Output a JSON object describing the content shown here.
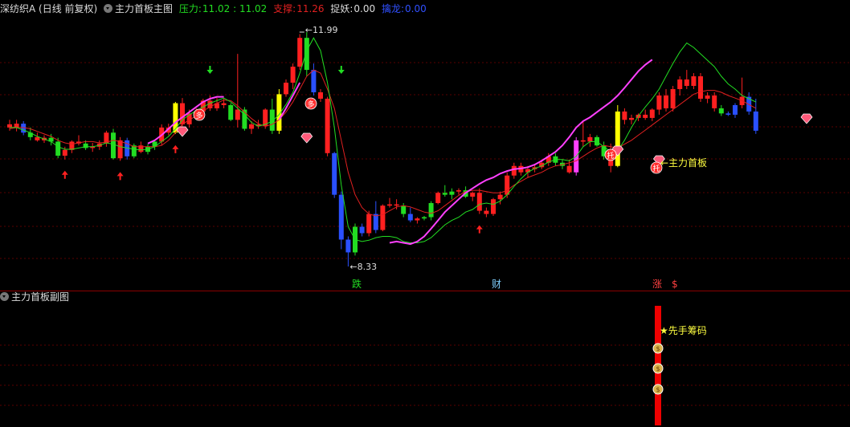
{
  "main_header": {
    "security": "深纺织A (日线 前复权)",
    "indicator": "主力首板主图",
    "pressure_label": "压力:",
    "pressure_value": "11.02 : 11.02",
    "support_label": "支撑:",
    "support_value": "11.26",
    "catch_label": "捉妖:",
    "catch_value": "0.00",
    "capture_label": "擒龙:",
    "capture_value": "0.00"
  },
  "sub_header": {
    "indicator": "主力首板副图"
  },
  "annotations": {
    "high_price": "11.99",
    "low_price": "8.33",
    "first_board": "主力首板",
    "first_chips": "★先手筹码",
    "markers": [
      "跌",
      "财",
      "涨",
      "$"
    ],
    "badge_multi": "多",
    "badge_tuo": "托"
  },
  "colors": {
    "background": "#000000",
    "up": "#ff2020",
    "down": "#2a50ff",
    "green_candle": "#22dd22",
    "ma_red": "#e02020",
    "ma_green": "#22dd22",
    "ma_magenta": "#ff40ff",
    "highlight_yellow": "#ffff00",
    "grid": "#5a0000"
  },
  "chart_data": {
    "type": "candlestick",
    "price_range": [
      8.33,
      11.99
    ],
    "candles": [
      {
        "o": 10.55,
        "h": 10.62,
        "l": 10.45,
        "c": 10.5,
        "k": "u"
      },
      {
        "o": 10.5,
        "h": 10.62,
        "l": 10.44,
        "c": 10.56,
        "k": "u"
      },
      {
        "o": 10.56,
        "h": 10.6,
        "l": 10.38,
        "c": 10.42,
        "k": "d"
      },
      {
        "o": 10.42,
        "h": 10.5,
        "l": 10.3,
        "c": 10.35,
        "k": "g"
      },
      {
        "o": 10.35,
        "h": 10.42,
        "l": 10.28,
        "c": 10.3,
        "k": "u"
      },
      {
        "o": 10.3,
        "h": 10.38,
        "l": 10.26,
        "c": 10.34,
        "k": "u"
      },
      {
        "o": 10.34,
        "h": 10.4,
        "l": 10.22,
        "c": 10.28,
        "k": "g"
      },
      {
        "o": 10.28,
        "h": 10.34,
        "l": 10.02,
        "c": 10.06,
        "k": "g"
      },
      {
        "o": 10.06,
        "h": 10.2,
        "l": 10.0,
        "c": 10.15,
        "k": "u"
      },
      {
        "o": 10.15,
        "h": 10.3,
        "l": 10.1,
        "c": 10.28,
        "k": "u"
      },
      {
        "o": 10.28,
        "h": 10.38,
        "l": 10.22,
        "c": 10.25,
        "k": "u"
      },
      {
        "o": 10.25,
        "h": 10.3,
        "l": 10.15,
        "c": 10.18,
        "k": "g"
      },
      {
        "o": 10.18,
        "h": 10.26,
        "l": 10.12,
        "c": 10.2,
        "k": "u"
      },
      {
        "o": 10.2,
        "h": 10.3,
        "l": 10.15,
        "c": 10.25,
        "k": "u"
      },
      {
        "o": 10.25,
        "h": 10.45,
        "l": 10.2,
        "c": 10.42,
        "k": "u"
      },
      {
        "o": 10.42,
        "h": 10.48,
        "l": 10.0,
        "c": 10.02,
        "k": "g"
      },
      {
        "o": 10.02,
        "h": 10.35,
        "l": 9.98,
        "c": 10.3,
        "k": "u"
      },
      {
        "o": 10.3,
        "h": 10.34,
        "l": 10.0,
        "c": 10.05,
        "k": "d"
      },
      {
        "o": 10.05,
        "h": 10.25,
        "l": 10.02,
        "c": 10.22,
        "k": "g"
      },
      {
        "o": 10.22,
        "h": 10.28,
        "l": 10.1,
        "c": 10.12,
        "k": "u"
      },
      {
        "o": 10.12,
        "h": 10.24,
        "l": 10.08,
        "c": 10.2,
        "k": "g"
      },
      {
        "o": 10.2,
        "h": 10.3,
        "l": 10.15,
        "c": 10.28,
        "k": "g"
      },
      {
        "o": 10.28,
        "h": 10.55,
        "l": 10.22,
        "c": 10.5,
        "k": "u"
      },
      {
        "o": 10.5,
        "h": 10.56,
        "l": 10.38,
        "c": 10.42,
        "k": "u"
      },
      {
        "o": 10.42,
        "h": 10.9,
        "l": 10.4,
        "c": 10.88,
        "k": "y"
      },
      {
        "o": 10.88,
        "h": 10.96,
        "l": 10.5,
        "c": 10.55,
        "k": "u"
      },
      {
        "o": 10.55,
        "h": 10.78,
        "l": 10.5,
        "c": 10.72,
        "k": "u"
      },
      {
        "o": 10.72,
        "h": 10.8,
        "l": 10.66,
        "c": 10.75,
        "k": "u"
      },
      {
        "o": 10.75,
        "h": 10.95,
        "l": 10.7,
        "c": 10.92,
        "k": "u"
      },
      {
        "o": 10.92,
        "h": 11.0,
        "l": 10.76,
        "c": 10.8,
        "k": "u"
      },
      {
        "o": 10.8,
        "h": 10.96,
        "l": 10.76,
        "c": 10.88,
        "k": "u"
      },
      {
        "o": 10.88,
        "h": 10.95,
        "l": 10.8,
        "c": 10.85,
        "k": "u"
      },
      {
        "o": 10.85,
        "h": 10.88,
        "l": 10.6,
        "c": 10.62,
        "k": "g"
      },
      {
        "o": 10.62,
        "h": 11.65,
        "l": 10.5,
        "c": 10.78,
        "k": "u"
      },
      {
        "o": 10.78,
        "h": 10.82,
        "l": 10.45,
        "c": 10.48,
        "k": "g"
      },
      {
        "o": 10.48,
        "h": 10.6,
        "l": 10.4,
        "c": 10.55,
        "k": "u"
      },
      {
        "o": 10.55,
        "h": 10.62,
        "l": 10.48,
        "c": 10.52,
        "k": "u"
      },
      {
        "o": 10.52,
        "h": 10.8,
        "l": 10.48,
        "c": 10.78,
        "k": "u"
      },
      {
        "o": 10.78,
        "h": 10.95,
        "l": 10.4,
        "c": 10.45,
        "k": "g"
      },
      {
        "o": 10.45,
        "h": 11.1,
        "l": 10.4,
        "c": 11.02,
        "k": "y"
      },
      {
        "o": 11.02,
        "h": 11.25,
        "l": 10.98,
        "c": 11.2,
        "k": "u"
      },
      {
        "o": 11.2,
        "h": 11.5,
        "l": 11.1,
        "c": 11.45,
        "k": "u"
      },
      {
        "o": 11.45,
        "h": 11.96,
        "l": 11.4,
        "c": 11.9,
        "k": "u"
      },
      {
        "o": 11.9,
        "h": 11.99,
        "l": 11.3,
        "c": 11.4,
        "k": "g"
      },
      {
        "o": 11.4,
        "h": 11.5,
        "l": 11.0,
        "c": 11.05,
        "k": "d"
      },
      {
        "o": 11.05,
        "h": 11.1,
        "l": 10.9,
        "c": 10.95,
        "k": "u"
      },
      {
        "o": 10.95,
        "h": 10.98,
        "l": 10.05,
        "c": 10.1,
        "k": "u"
      },
      {
        "o": 10.1,
        "h": 10.12,
        "l": 9.4,
        "c": 9.45,
        "k": "d"
      },
      {
        "o": 9.45,
        "h": 9.5,
        "l": 8.6,
        "c": 8.75,
        "k": "d"
      },
      {
        "o": 8.75,
        "h": 8.8,
        "l": 8.33,
        "c": 8.55,
        "k": "d"
      },
      {
        "o": 8.55,
        "h": 9.0,
        "l": 8.5,
        "c": 8.95,
        "k": "g"
      },
      {
        "o": 8.95,
        "h": 9.0,
        "l": 8.8,
        "c": 8.85,
        "k": "d"
      },
      {
        "o": 8.85,
        "h": 9.2,
        "l": 8.8,
        "c": 9.15,
        "k": "u"
      },
      {
        "o": 9.15,
        "h": 9.35,
        "l": 8.85,
        "c": 8.9,
        "k": "d"
      },
      {
        "o": 8.9,
        "h": 9.3,
        "l": 8.88,
        "c": 9.28,
        "k": "u"
      },
      {
        "o": 9.28,
        "h": 9.4,
        "l": 9.25,
        "c": 9.3,
        "k": "u"
      },
      {
        "o": 9.3,
        "h": 9.38,
        "l": 9.22,
        "c": 9.28,
        "k": "u"
      },
      {
        "o": 9.28,
        "h": 9.32,
        "l": 9.1,
        "c": 9.15,
        "k": "g"
      },
      {
        "o": 9.15,
        "h": 9.25,
        "l": 9.02,
        "c": 9.05,
        "k": "d"
      },
      {
        "o": 9.05,
        "h": 9.1,
        "l": 9.0,
        "c": 9.08,
        "k": "u"
      },
      {
        "o": 9.08,
        "h": 9.12,
        "l": 9.05,
        "c": 9.1,
        "k": "g"
      },
      {
        "o": 9.1,
        "h": 9.35,
        "l": 9.05,
        "c": 9.32,
        "k": "g"
      },
      {
        "o": 9.32,
        "h": 9.5,
        "l": 9.3,
        "c": 9.48,
        "k": "u"
      },
      {
        "o": 9.48,
        "h": 9.6,
        "l": 9.42,
        "c": 9.45,
        "k": "g"
      },
      {
        "o": 9.45,
        "h": 9.55,
        "l": 9.38,
        "c": 9.5,
        "k": "g"
      },
      {
        "o": 9.5,
        "h": 9.55,
        "l": 9.45,
        "c": 9.52,
        "k": "u"
      },
      {
        "o": 9.52,
        "h": 9.58,
        "l": 9.4,
        "c": 9.42,
        "k": "g"
      },
      {
        "o": 9.42,
        "h": 9.5,
        "l": 9.35,
        "c": 9.48,
        "k": "u"
      },
      {
        "o": 9.48,
        "h": 9.55,
        "l": 9.15,
        "c": 9.2,
        "k": "u"
      },
      {
        "o": 9.2,
        "h": 9.25,
        "l": 9.1,
        "c": 9.15,
        "k": "u"
      },
      {
        "o": 9.15,
        "h": 9.4,
        "l": 9.12,
        "c": 9.38,
        "k": "u"
      },
      {
        "o": 9.38,
        "h": 9.5,
        "l": 9.3,
        "c": 9.45,
        "k": "u"
      },
      {
        "o": 9.45,
        "h": 9.8,
        "l": 9.4,
        "c": 9.75,
        "k": "u"
      },
      {
        "o": 9.75,
        "h": 9.95,
        "l": 9.7,
        "c": 9.9,
        "k": "u"
      },
      {
        "o": 9.9,
        "h": 9.95,
        "l": 9.75,
        "c": 9.8,
        "k": "u"
      },
      {
        "o": 9.8,
        "h": 9.9,
        "l": 9.72,
        "c": 9.85,
        "k": "u"
      },
      {
        "o": 9.85,
        "h": 9.92,
        "l": 9.8,
        "c": 9.88,
        "k": "u"
      },
      {
        "o": 9.88,
        "h": 10.0,
        "l": 9.85,
        "c": 9.95,
        "k": "u"
      },
      {
        "o": 9.95,
        "h": 10.1,
        "l": 9.9,
        "c": 10.05,
        "k": "u"
      },
      {
        "o": 10.05,
        "h": 10.1,
        "l": 9.9,
        "c": 9.95,
        "k": "g"
      },
      {
        "o": 9.95,
        "h": 10.0,
        "l": 9.85,
        "c": 9.9,
        "k": "g"
      },
      {
        "o": 9.9,
        "h": 10.0,
        "l": 9.78,
        "c": 9.8,
        "k": "u"
      },
      {
        "o": 9.8,
        "h": 10.35,
        "l": 9.75,
        "c": 10.3,
        "k": "p"
      },
      {
        "o": 10.3,
        "h": 10.6,
        "l": 10.2,
        "c": 10.28,
        "k": "u"
      },
      {
        "o": 10.28,
        "h": 10.4,
        "l": 10.2,
        "c": 10.35,
        "k": "u"
      },
      {
        "o": 10.35,
        "h": 10.38,
        "l": 10.2,
        "c": 10.22,
        "k": "g"
      },
      {
        "o": 10.22,
        "h": 10.28,
        "l": 10.0,
        "c": 10.05,
        "k": "g"
      },
      {
        "o": 10.05,
        "h": 10.25,
        "l": 9.8,
        "c": 9.9,
        "k": "u"
      },
      {
        "o": 9.9,
        "h": 10.85,
        "l": 9.88,
        "c": 10.75,
        "k": "y"
      },
      {
        "o": 10.75,
        "h": 10.8,
        "l": 10.55,
        "c": 10.62,
        "k": "u"
      },
      {
        "o": 10.62,
        "h": 10.7,
        "l": 10.55,
        "c": 10.65,
        "k": "u"
      },
      {
        "o": 10.65,
        "h": 10.72,
        "l": 10.6,
        "c": 10.7,
        "k": "u"
      },
      {
        "o": 10.7,
        "h": 10.78,
        "l": 10.62,
        "c": 10.65,
        "k": "u"
      },
      {
        "o": 10.65,
        "h": 10.8,
        "l": 10.6,
        "c": 10.78,
        "k": "u"
      },
      {
        "o": 10.78,
        "h": 11.05,
        "l": 10.7,
        "c": 11.0,
        "k": "u"
      },
      {
        "o": 11.0,
        "h": 11.1,
        "l": 10.75,
        "c": 10.8,
        "k": "u"
      },
      {
        "o": 10.8,
        "h": 11.15,
        "l": 10.75,
        "c": 11.1,
        "k": "u"
      },
      {
        "o": 11.1,
        "h": 11.3,
        "l": 11.0,
        "c": 11.25,
        "k": "u"
      },
      {
        "o": 11.25,
        "h": 11.4,
        "l": 11.1,
        "c": 11.15,
        "k": "u"
      },
      {
        "o": 11.15,
        "h": 11.35,
        "l": 11.1,
        "c": 11.3,
        "k": "u"
      },
      {
        "o": 11.3,
        "h": 11.35,
        "l": 10.9,
        "c": 10.95,
        "k": "u"
      },
      {
        "o": 10.95,
        "h": 11.05,
        "l": 10.88,
        "c": 11.0,
        "k": "u"
      },
      {
        "o": 11.0,
        "h": 11.05,
        "l": 10.75,
        "c": 10.8,
        "k": "u"
      },
      {
        "o": 10.8,
        "h": 10.85,
        "l": 10.68,
        "c": 10.72,
        "k": "g"
      },
      {
        "o": 10.72,
        "h": 10.75,
        "l": 10.68,
        "c": 10.7,
        "k": "d"
      },
      {
        "o": 10.7,
        "h": 10.88,
        "l": 10.65,
        "c": 10.85,
        "k": "d"
      },
      {
        "o": 10.85,
        "h": 11.28,
        "l": 10.8,
        "c": 10.98,
        "k": "u"
      },
      {
        "o": 10.98,
        "h": 11.05,
        "l": 10.7,
        "c": 10.75,
        "k": "d"
      },
      {
        "o": 10.75,
        "h": 10.95,
        "l": 10.4,
        "c": 10.45,
        "k": "d"
      }
    ],
    "ma_red": [
      10.48,
      10.5,
      10.5,
      10.48,
      10.44,
      10.4,
      10.36,
      10.3,
      10.26,
      10.24,
      10.26,
      10.28,
      10.28,
      10.26,
      10.27,
      10.3,
      10.28,
      10.25,
      10.2,
      10.2,
      10.2,
      10.2,
      10.22,
      10.3,
      10.42,
      10.55,
      10.62,
      10.68,
      10.76,
      10.82,
      10.88,
      10.93,
      10.92,
      10.84,
      10.74,
      10.64,
      10.56,
      10.52,
      10.55,
      10.62,
      10.74,
      10.9,
      11.1,
      11.3,
      11.4,
      11.35,
      11.1,
      10.8,
      10.3,
      9.8,
      9.45,
      9.25,
      9.15,
      9.12,
      9.14,
      9.2,
      9.26,
      9.28,
      9.26,
      9.22,
      9.18,
      9.16,
      9.2,
      9.28,
      9.36,
      9.44,
      9.5,
      9.52,
      9.52,
      9.5,
      9.48,
      9.48,
      9.52,
      9.6,
      9.66,
      9.72,
      9.76,
      9.8,
      9.86,
      9.9,
      9.92,
      9.95,
      9.98,
      10.05,
      10.12,
      10.18,
      10.22,
      10.2,
      10.18,
      10.24,
      10.3,
      10.38,
      10.46,
      10.54,
      10.62,
      10.7,
      10.78,
      10.86,
      10.94,
      11.02,
      11.06,
      11.08,
      11.08,
      11.05,
      11.0,
      10.96,
      10.92,
      10.86,
      10.8
    ],
    "ma_green": [
      10.5,
      10.5,
      10.46,
      10.42,
      10.36,
      10.32,
      10.28,
      10.2,
      10.16,
      10.16,
      10.18,
      10.2,
      10.2,
      10.22,
      10.26,
      10.24,
      10.2,
      10.18,
      10.16,
      10.15,
      10.16,
      10.2,
      10.28,
      10.36,
      10.48,
      10.62,
      10.7,
      10.76,
      10.82,
      10.88,
      10.92,
      10.96,
      10.9,
      10.8,
      10.7,
      10.58,
      10.52,
      10.55,
      10.6,
      10.7,
      10.86,
      11.05,
      11.35,
      11.7,
      11.9,
      11.7,
      11.2,
      10.5,
      9.6,
      8.95,
      8.75,
      8.72,
      8.74,
      8.78,
      8.8,
      8.8,
      8.78,
      8.72,
      8.7,
      8.7,
      8.72,
      8.78,
      8.88,
      8.98,
      9.05,
      9.1,
      9.18,
      9.22,
      9.3,
      9.32,
      9.3,
      9.35,
      9.45,
      9.58,
      9.7,
      9.8,
      9.86,
      9.9,
      9.96,
      10.0,
      10.0,
      9.98,
      10.05,
      10.2,
      10.28,
      10.28,
      10.2,
      10.12,
      10.14,
      10.3,
      10.5,
      10.68,
      10.82,
      10.95,
      11.1,
      11.3,
      11.5,
      11.68,
      11.82,
      11.75,
      11.65,
      11.55,
      11.45,
      11.3,
      11.18,
      11.1,
      11.0,
      10.95,
      10.9
    ],
    "ma_magenta": [
      null,
      null,
      null,
      null,
      null,
      null,
      null,
      null,
      null,
      null,
      null,
      null,
      null,
      null,
      null,
      null,
      null,
      null,
      null,
      null,
      10.25,
      10.3,
      10.38,
      10.48,
      10.58,
      10.66,
      10.74,
      10.82,
      10.9,
      10.95,
      10.98,
      10.98,
      null,
      null,
      null,
      null,
      null,
      null,
      null,
      10.62,
      10.8,
      11.0,
      11.2,
      null,
      null,
      null,
      null,
      null,
      null,
      null,
      null,
      null,
      null,
      null,
      null,
      8.7,
      8.72,
      8.7,
      8.68,
      8.72,
      8.8,
      8.92,
      9.05,
      9.18,
      9.28,
      9.38,
      9.48,
      9.55,
      9.62,
      9.68,
      9.72,
      9.78,
      9.82,
      9.85,
      9.86,
      9.88,
      9.92,
      9.98,
      10.05,
      10.12,
      10.22,
      10.35,
      10.5,
      10.6,
      10.66,
      10.74,
      10.82,
      10.9,
      11.0,
      11.12,
      11.25,
      11.38,
      11.48,
      11.56,
      null,
      null,
      null,
      null,
      null,
      null,
      null,
      null,
      null,
      null,
      null
    ]
  }
}
